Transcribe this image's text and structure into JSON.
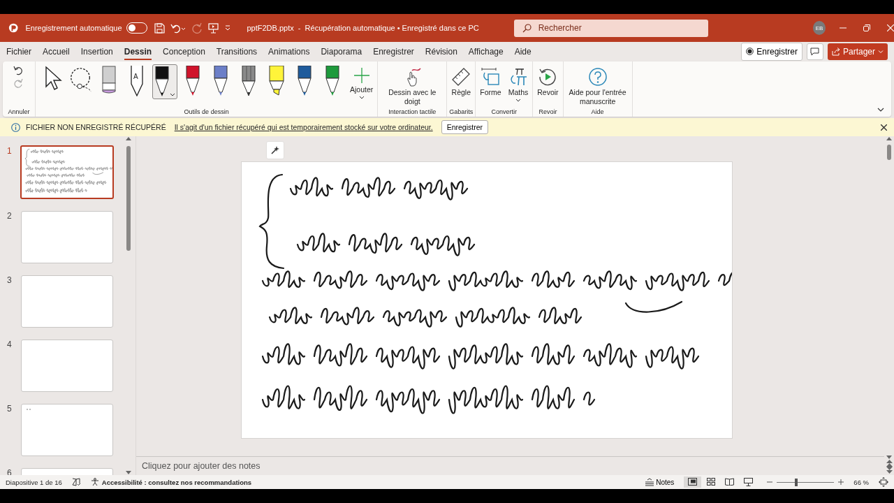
{
  "title_bar": {
    "autosave_label": "Enregistrement automatique",
    "autosave_on": false,
    "redo_disabled": true,
    "document_title": "pptF2DB.pptx  -  Récupération automatique • Enregistré dans ce PC",
    "search": {
      "placeholder": "Rechercher"
    },
    "avatar": "EB"
  },
  "menu_tabs": [
    {
      "label": "Fichier",
      "selected": false
    },
    {
      "label": "Accueil",
      "selected": false
    },
    {
      "label": "Insertion",
      "selected": false
    },
    {
      "label": "Dessin",
      "selected": true
    },
    {
      "label": "Conception",
      "selected": false
    },
    {
      "label": "Transitions",
      "selected": false
    },
    {
      "label": "Animations",
      "selected": false
    },
    {
      "label": "Diaporama",
      "selected": false
    },
    {
      "label": "Enregistrer",
      "selected": false
    },
    {
      "label": "Révision",
      "selected": false
    },
    {
      "label": "Affichage",
      "selected": false
    },
    {
      "label": "Aide",
      "selected": false
    }
  ],
  "header_buttons": {
    "record": "Enregistrer",
    "share": "Partager"
  },
  "ribbon": {
    "groups": [
      {
        "kind": "undo",
        "label": "Annuler"
      },
      {
        "kind": "tools",
        "label": "Outils de dessin",
        "add_label": "Ajouter",
        "tools": [
          {
            "kind": "select",
            "selected": false
          },
          {
            "kind": "lasso",
            "selected": false
          },
          {
            "kind": "eraser",
            "selected": false
          },
          {
            "kind": "text-pen",
            "glyph": "A",
            "selected": false
          },
          {
            "kind": "pen",
            "color": "#111111",
            "selected": true
          },
          {
            "kind": "pen",
            "color": "#d0132b",
            "selected": false
          },
          {
            "kind": "pen",
            "color": "#6c7fc8",
            "selected": false
          },
          {
            "kind": "pencil",
            "color": "#8a8a8a",
            "selected": false
          },
          {
            "kind": "highlighter",
            "color": "#fff43a",
            "selected": false
          },
          {
            "kind": "pen",
            "color": "#1e5b9c",
            "selected": false
          },
          {
            "kind": "pen",
            "color": "#1e9a3c",
            "selected": false
          }
        ]
      },
      {
        "kind": "buttons",
        "label": "Interaction tactile",
        "buttons": [
          {
            "kind": "finger",
            "label": "Dessin avec le doigt"
          }
        ]
      },
      {
        "kind": "buttons",
        "label": "Gabarits",
        "buttons": [
          {
            "kind": "ruler",
            "label": "Règle"
          }
        ]
      },
      {
        "kind": "buttons",
        "label": "Convertir",
        "buttons": [
          {
            "kind": "shape",
            "label": "Forme"
          },
          {
            "kind": "math",
            "label": "Maths",
            "dropdown": true
          }
        ]
      },
      {
        "kind": "buttons",
        "label": "Revoir",
        "buttons": [
          {
            "kind": "replay",
            "label": "Revoir"
          }
        ]
      },
      {
        "kind": "buttons",
        "label": "Aide",
        "buttons": [
          {
            "kind": "help",
            "label": "Aide pour l'entrée manuscrite"
          }
        ]
      }
    ]
  },
  "info_bar": {
    "title": "FICHIER NON ENREGISTRÉ RÉCUPÉRÉ",
    "message": "Il s'agit d'un fichier récupéré qui est temporairement stocké sur votre ordinateur.",
    "button": "Enregistrer"
  },
  "slides": [
    {
      "number": "1",
      "kind": "ink",
      "selected": true
    },
    {
      "number": "2",
      "kind": "blank",
      "selected": false
    },
    {
      "number": "3",
      "kind": "blank",
      "selected": false
    },
    {
      "number": "4",
      "kind": "blank",
      "selected": false
    },
    {
      "number": "5",
      "kind": "dots",
      "selected": false
    },
    {
      "number": "6",
      "kind": "blank",
      "selected": false
    }
  ],
  "notes": {
    "placeholder": "Cliquez pour ajouter des notes"
  },
  "status_bar": {
    "slide_position": "Diapositive 1 de 16",
    "accessibility": "Accessibilité : consultez nos recommandations",
    "notes": "Notes",
    "zoom_slider": {
      "level": 0.33
    },
    "zoom_percent": "66 %"
  }
}
